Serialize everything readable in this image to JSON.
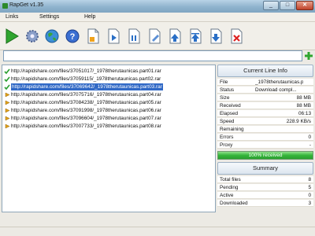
{
  "window": {
    "title": "RapGet v1.35"
  },
  "menu": {
    "items": [
      "Links",
      "Settings",
      "Help"
    ]
  },
  "toolbar": {
    "buttons": [
      "start-icon",
      "settings-gear-icon",
      "globe-icon",
      "help-icon",
      "document-icon",
      "document-move-icon",
      "document-icon",
      "document-edit-icon",
      "document-up-icon",
      "document-up-icon",
      "document-down-icon",
      "document-delete-icon"
    ]
  },
  "url_input": {
    "value": ""
  },
  "links": [
    {
      "url": "http://rapidshare.com/files/37051017/_1978therutaunicas.part01.rar",
      "status": "done"
    },
    {
      "url": "http://rapidshare.com/files/37059115/_1978therutaunicas.part02.rar",
      "status": "done"
    },
    {
      "url": "http://rapidshare.com/files/37069642/_1978therutaunicas.part03.rar",
      "status": "done"
    },
    {
      "url": "http://rapidshare.com/files/37075716/_1978therutaunicas.part04.rar",
      "status": "pending"
    },
    {
      "url": "http://rapidshare.com/files/37084238/_1978therutaunicas.part05.rar",
      "status": "pending"
    },
    {
      "url": "http://rapidshare.com/files/37091998/_1978therutaunicas.part06.rar",
      "status": "pending"
    },
    {
      "url": "http://rapidshare.com/files/37096604/_1978therutaunicas.part07.rar",
      "status": "pending"
    },
    {
      "url": "http://rapidshare.com/files/37007733/_1978therutaunicas.part08.rar",
      "status": "pending"
    }
  ],
  "current_info": {
    "header": "Current Line Info",
    "rows": [
      {
        "key": "File",
        "value": "_1978therutaunicas.p"
      },
      {
        "key": "Status",
        "value": "Download compl..."
      },
      {
        "key": "Size",
        "value": "88 MB"
      },
      {
        "key": "Received",
        "value": "88 MB"
      },
      {
        "key": "Elapsed",
        "value": "06:13"
      },
      {
        "key": "Speed",
        "value": "228.9 KB/s"
      },
      {
        "key": "Remaining",
        "value": ""
      },
      {
        "key": "Errors",
        "value": "0"
      },
      {
        "key": "Proxy",
        "value": "-"
      }
    ],
    "progress_label": "100% received",
    "progress_fraction": 1.0
  },
  "summary": {
    "header": "Summary",
    "rows": [
      {
        "key": "Total files",
        "value": "8"
      },
      {
        "key": "Pending",
        "value": "5"
      },
      {
        "key": "Active",
        "value": "0"
      },
      {
        "key": "Downloaded",
        "value": "3"
      }
    ]
  },
  "colors": {
    "selection": "#3169c6",
    "progress": "#34b53a",
    "titlebar": "#8fb3cd"
  }
}
